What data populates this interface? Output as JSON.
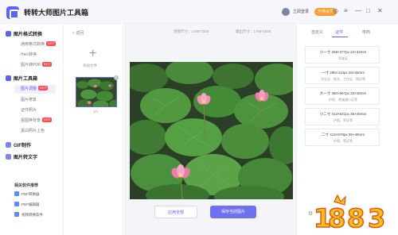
{
  "app": {
    "title": "转转大师图片工具箱",
    "login": "立即登录",
    "vip": "开通会员",
    "controls": [
      "◎",
      "≡",
      "—",
      "□",
      "✕"
    ]
  },
  "sidebar": {
    "sections": [
      {
        "label": "图片格式转换",
        "items": [
          {
            "label": "通用格式转换",
            "hot": "HOT"
          },
          {
            "label": "Heic转换",
            "hot": ""
          },
          {
            "label": "图片转PDF",
            "hot": "HOT"
          }
        ]
      },
      {
        "label": "图片工具箱",
        "items": [
          {
            "label": "图片调整",
            "hot": "HOT",
            "active": true
          },
          {
            "label": "图片修复",
            "hot": ""
          },
          {
            "label": "证件照片",
            "hot": ""
          },
          {
            "label": "抠图换背景",
            "hot": "HOT"
          },
          {
            "label": "黑白照片上色",
            "hot": ""
          }
        ]
      },
      {
        "label": "GIF制作",
        "items": []
      },
      {
        "label": "图片转文字",
        "items": []
      }
    ],
    "recommend_title": "相关软件推荐",
    "recommend": [
      "PDF转换器",
      "PDF编辑器",
      "视频转换软件"
    ]
  },
  "thumbs": {
    "back": "< 返回",
    "add_label": "添加文件",
    "plus": "+",
    "caption": "1/1",
    "close": "✕"
  },
  "main": {
    "original_size": "原图尺寸：1768*1500",
    "output_size": "输出尺寸：1768*1500",
    "buttons": {
      "apply_all": "应用全部",
      "save_current": "保存当前图片"
    }
  },
  "right": {
    "tabs": [
      "自定义",
      "证件",
      "电商"
    ],
    "active_tab": 1,
    "presets": [
      {
        "name": "小一寸 259×377px 22×32mm",
        "note": "驾驶证"
      },
      {
        "name": "一寸 295×413px 25×35mm",
        "note": "毕业证、报名、工作证、简历等"
      },
      {
        "name": "大一寸 390×567px 33×48mm",
        "note": "护照、港澳通行证等"
      },
      {
        "name": "小二寸 413×531px 35×45mm",
        "note": "护照、签证等"
      },
      {
        "name": "二寸 413×579px 35×49mm",
        "note": "护照、签证等"
      }
    ],
    "settings_icon": "⚙"
  },
  "colors": {
    "accent": "#5b63f6",
    "button_primary": "#6e70f2",
    "hot_badge": "#ff4d4f",
    "vip_badge": "#ff9a2e"
  },
  "watermark": "1883"
}
